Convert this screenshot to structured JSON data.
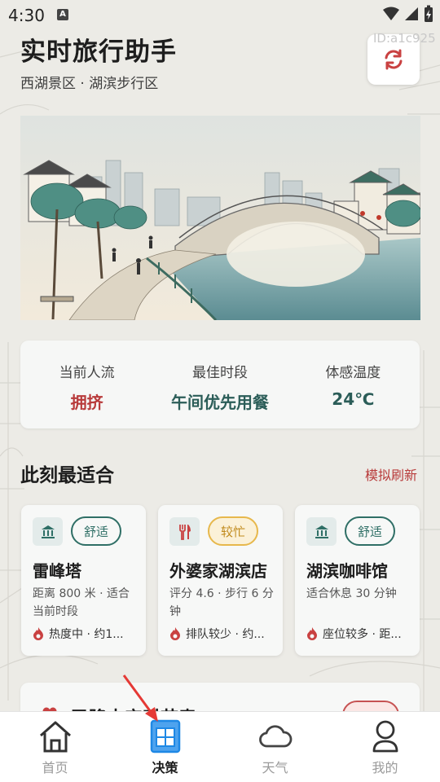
{
  "status_bar": {
    "time": "4:30",
    "a_icon": "A"
  },
  "header": {
    "title": "实时旅行助手",
    "subtitle": "西湖景区 · 湖滨步行区",
    "device_id": "ID:a1c925",
    "refresh_icon": "refresh-icon"
  },
  "stats": [
    {
      "label": "当前人流",
      "value": "拥挤"
    },
    {
      "label": "最佳时段",
      "value": "午间优先用餐"
    },
    {
      "label": "体感温度",
      "value": "24℃"
    }
  ],
  "section": {
    "title": "此刻最适合",
    "action": "模拟刷新"
  },
  "cards": [
    {
      "icon": "landmark-icon",
      "badge": "舒适",
      "name": "雷峰塔",
      "desc": "距离 800 米 · 适合当前时段",
      "foot": "热度中 · 约1..."
    },
    {
      "icon": "restaurant-icon",
      "badge": "较忙",
      "name": "外婆家湖滨店",
      "desc": "评分 4.6 · 步行 6 分钟",
      "foot": "排队较少 · 约..."
    },
    {
      "icon": "landmark-icon",
      "badge": "舒适",
      "name": "湖滨咖啡馆",
      "desc": "适合休息 30 分钟",
      "foot": "座位较多 · 距..."
    }
  ],
  "peek": {
    "title": "已降本实时节奏"
  },
  "tabs": [
    {
      "label": "首页",
      "icon": "home-icon"
    },
    {
      "label": "决策",
      "icon": "decision-icon"
    },
    {
      "label": "天气",
      "icon": "cloud-icon"
    },
    {
      "label": "我的",
      "icon": "profile-icon"
    }
  ],
  "colors": {
    "accent_red": "#b83b3b",
    "accent_teal": "#2b5d58",
    "busy_yellow": "#e7b84c",
    "tab_active_blue": "#1e88e5"
  }
}
